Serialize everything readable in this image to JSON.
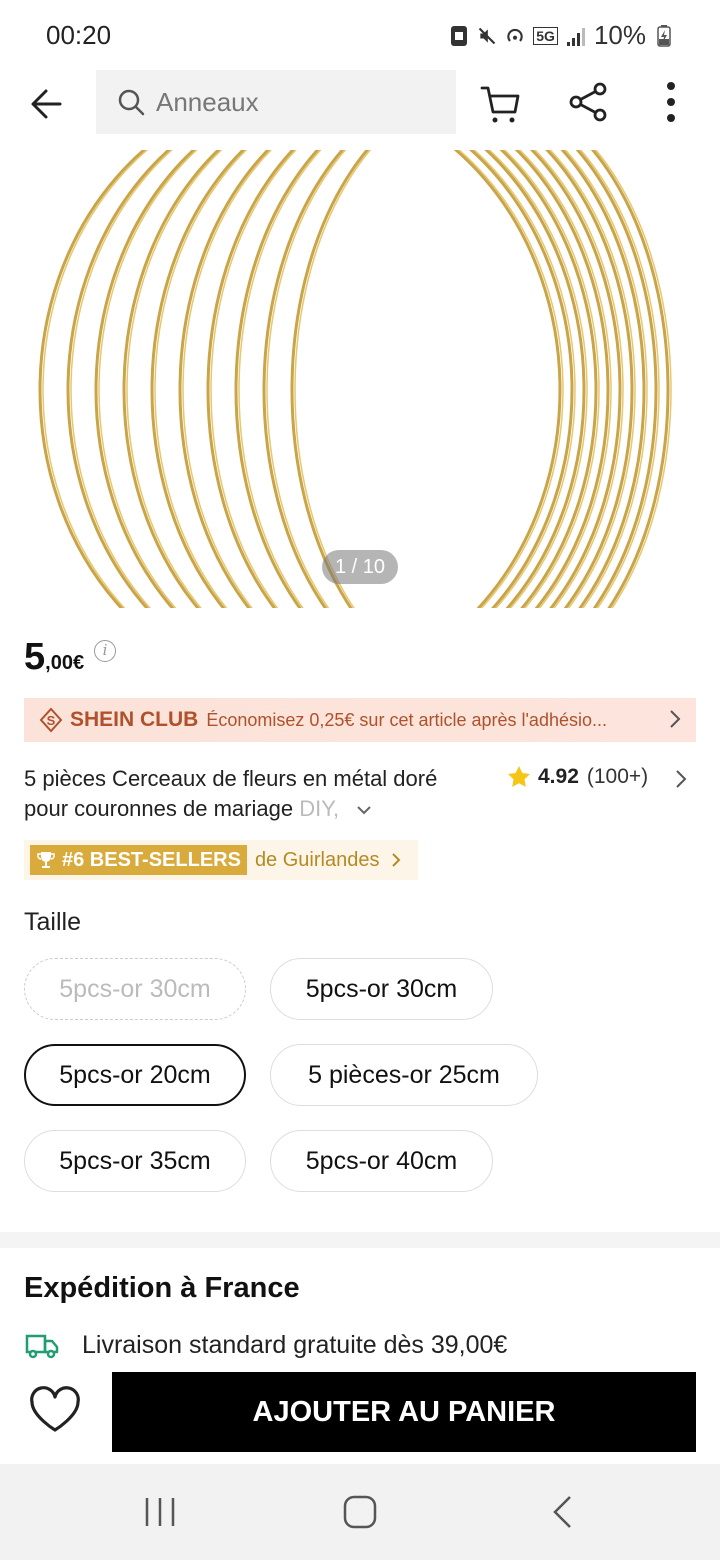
{
  "status_bar": {
    "time": "00:20",
    "network": "5G",
    "battery": "10%"
  },
  "header": {
    "search_placeholder": "Anneaux",
    "icons": [
      "back-arrow-icon",
      "search-icon",
      "cart-icon",
      "share-icon",
      "more-vertical-icon"
    ]
  },
  "gallery": {
    "counter": "1 / 10",
    "ring_color": "#c9a448"
  },
  "price": {
    "integer": "5",
    "decimal": ",00€"
  },
  "club": {
    "title": "SHEIN CLUB",
    "text": "Économisez 0,25€ sur cet article après l'adhésio..."
  },
  "product": {
    "title_main": "5 pièces Cerceaux de fleurs en métal doré pour couronnes de mariage",
    "title_fade": "DIY,",
    "rating": "4.92",
    "rating_count": "(100+)"
  },
  "bestseller": {
    "badge": "#6 BEST-SELLERS",
    "category": "de Guirlandes"
  },
  "size": {
    "label": "Taille",
    "options": [
      {
        "label": "5pcs-or 30cm",
        "state": "disabled"
      },
      {
        "label": "5pcs-or 30cm",
        "state": "normal"
      },
      {
        "label": "5pcs-or 20cm",
        "state": "selected"
      },
      {
        "label": "5 pièces-or 25cm",
        "state": "normal"
      },
      {
        "label": "5pcs-or 35cm",
        "state": "normal"
      },
      {
        "label": "5pcs-or 40cm",
        "state": "normal"
      }
    ]
  },
  "shipping": {
    "title": "Expédition à France",
    "standard": "Livraison standard gratuite dès 39,00€"
  },
  "actions": {
    "add_to_cart": "AJOUTER AU PANIER"
  },
  "colors": {
    "club_accent": "#b0512b",
    "bestseller_gold": "#d9ab3c",
    "star": "#f5c518",
    "truck": "#1f9e6f"
  }
}
